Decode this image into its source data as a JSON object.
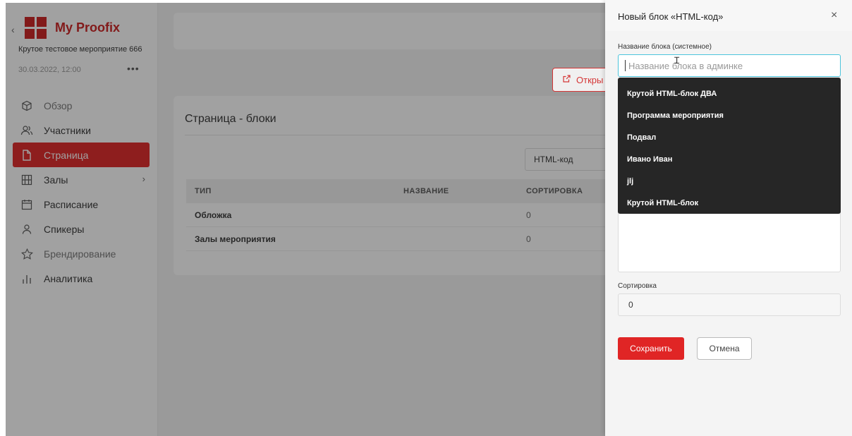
{
  "sidebar": {
    "brand": "My Proofix",
    "event_name": "Крутое тестовое мероприятие 666",
    "event_date": "30.03.2022, 12:00",
    "more": "•••",
    "items": [
      {
        "label": "Обзор",
        "icon": "cube-icon"
      },
      {
        "label": "Участники",
        "icon": "users-icon"
      },
      {
        "label": "Страница",
        "icon": "page-icon",
        "active": true
      },
      {
        "label": "Залы",
        "icon": "grid-icon",
        "arrow": "›"
      },
      {
        "label": "Расписание",
        "icon": "calendar-icon"
      },
      {
        "label": "Спикеры",
        "icon": "user-icon"
      },
      {
        "label": "Брендирование",
        "icon": "star-icon"
      },
      {
        "label": "Аналитика",
        "icon": "chart-icon"
      }
    ]
  },
  "main": {
    "open_button": "Откры",
    "card_title": "Страница - блоки",
    "type_select_value": "HTML-код",
    "table": {
      "headers": [
        "ТИП",
        "НАЗВАНИЕ",
        "СОРТИРОВКА"
      ],
      "rows": [
        [
          "Обложка",
          "",
          "0"
        ],
        [
          "Залы мероприятия",
          "",
          "0"
        ]
      ]
    }
  },
  "drawer": {
    "title": "Новый блок «HTML-код»",
    "close": "×",
    "name_label": "Название блока (системное)",
    "name_placeholder": "Название блока в админке",
    "suggestions": [
      "Крутой HTML-блок ДВА",
      "Программа мероприятия",
      "Подвал",
      "Ивано Иван",
      "jlj",
      "Крутой HTML-блок"
    ],
    "sort_label": "Сортировка",
    "sort_value": "0",
    "save_label": "Сохранить",
    "cancel_label": "Отмена"
  },
  "colors": {
    "accent": "#e02525",
    "focus": "#4cc4dc",
    "dropdown_bg": "#262626"
  }
}
